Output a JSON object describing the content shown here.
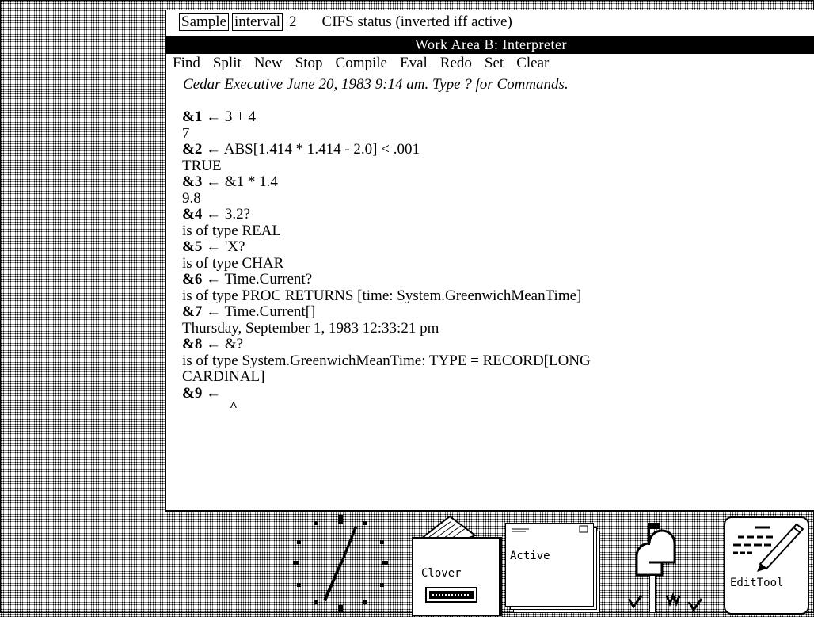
{
  "status_bar": {
    "sample_label": "Sample",
    "interval_label": "interval",
    "interval_value": "2",
    "cifs_status": "CIFS status (inverted iff active)"
  },
  "window": {
    "title": "Work Area B: Interpreter",
    "menu": [
      "Find",
      "Split",
      "New",
      "Stop",
      "Compile",
      "Eval",
      "Redo",
      "Set",
      "Clear"
    ]
  },
  "transcript": {
    "header": "Cedar Executive June 20, 1983 9:14 am. Type ? for Commands.",
    "lines": [
      {
        "prompt": "&1",
        "text": " ← 3 + 4"
      },
      {
        "prompt": "",
        "text": "7"
      },
      {
        "prompt": "&2",
        "text": " ← ABS[1.414 * 1.414 - 2.0] < .001"
      },
      {
        "prompt": "",
        "text": "TRUE"
      },
      {
        "prompt": "&3",
        "text": " ← &1 * 1.4"
      },
      {
        "prompt": "",
        "text": "9.8"
      },
      {
        "prompt": "&4",
        "text": " ← 3.2?"
      },
      {
        "prompt": "",
        "text": "is of type REAL"
      },
      {
        "prompt": "&5",
        "text": " ← 'X?"
      },
      {
        "prompt": "",
        "text": "is of type CHAR"
      },
      {
        "prompt": "&6",
        "text": " ← Time.Current?"
      },
      {
        "prompt": "",
        "text": "is of type PROC RETURNS [time: System.GreenwichMeanTime]"
      },
      {
        "prompt": "&7",
        "text": " ← Time.Current[]"
      },
      {
        "prompt": "",
        "text": "Thursday, September 1, 1983 12:33:21 pm"
      },
      {
        "prompt": "&8",
        "text": " ← &?"
      },
      {
        "prompt": "",
        "text": "is of type System.GreenwichMeanTime: TYPE = RECORD[LONG"
      },
      {
        "prompt": "",
        "text": "CARDINAL]"
      },
      {
        "prompt": "&9",
        "text": " ←"
      }
    ],
    "caret": "^"
  },
  "icons": {
    "clock": "clock-icon",
    "clover_label": "Clover",
    "active_label": "Active",
    "mailbox": "mailbox-icon",
    "edittool_label": "EditTool"
  }
}
